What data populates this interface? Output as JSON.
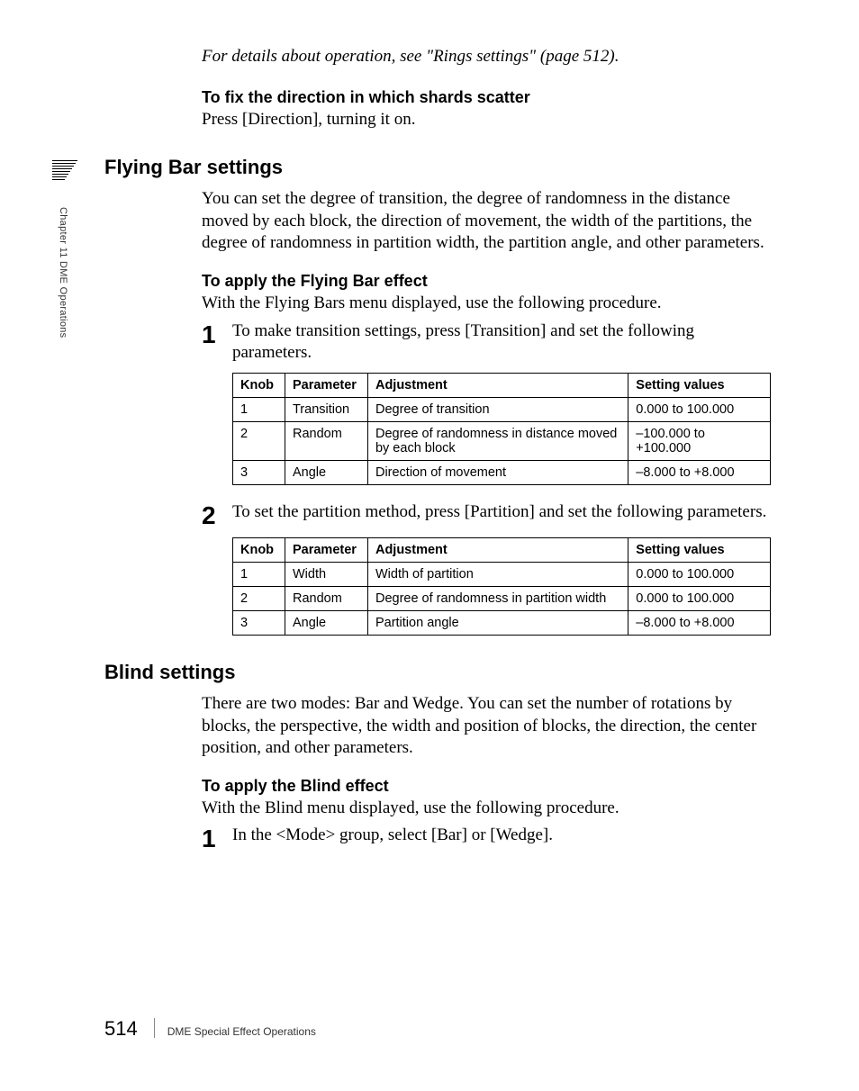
{
  "sidebar": {
    "chapter_label": "Chapter 11  DME Operations"
  },
  "intro": {
    "ref_italic": "For details about operation, see \"Rings settings\" (page 512).",
    "fix_dir_heading": "To fix the direction in which shards scatter",
    "fix_dir_body": "Press [Direction], turning it on."
  },
  "flying_bar": {
    "heading": "Flying Bar settings",
    "intro": "You can set the degree of transition, the degree of randomness in the distance moved by each block, the direction of movement, the width of the partitions, the degree of randomness in partition width, the partition angle, and other parameters.",
    "apply_heading": "To apply the Flying Bar effect",
    "apply_body": "With the Flying Bars menu displayed, use the following procedure.",
    "step1_num": "1",
    "step1_text": "To make transition settings, press [Transition] and set the following parameters.",
    "step2_num": "2",
    "step2_text": "To set the partition method, press [Partition] and set the following parameters.",
    "table_headers": {
      "knob": "Knob",
      "param": "Parameter",
      "adj": "Adjustment",
      "vals": "Setting values"
    },
    "table1": [
      {
        "knob": "1",
        "param": "Transition",
        "adj": "Degree of transition",
        "vals": "0.000 to 100.000"
      },
      {
        "knob": "2",
        "param": "Random",
        "adj": "Degree of randomness in distance moved by each block",
        "vals": "–100.000 to +100.000"
      },
      {
        "knob": "3",
        "param": "Angle",
        "adj": "Direction of movement",
        "vals": "–8.000 to +8.000"
      }
    ],
    "table2": [
      {
        "knob": "1",
        "param": "Width",
        "adj": "Width of partition",
        "vals": "0.000 to 100.000"
      },
      {
        "knob": "2",
        "param": "Random",
        "adj": "Degree of randomness in partition width",
        "vals": "0.000 to 100.000"
      },
      {
        "knob": "3",
        "param": "Angle",
        "adj": "Partition angle",
        "vals": "–8.000 to +8.000"
      }
    ]
  },
  "blind": {
    "heading": "Blind settings",
    "intro": "There are two modes: Bar and Wedge. You can set the number of rotations by blocks, the perspective, the width and position of blocks, the direction, the center position, and other parameters.",
    "apply_heading": "To apply the Blind effect",
    "apply_body": "With the Blind menu displayed, use the following procedure.",
    "step1_num": "1",
    "step1_text": "In the <Mode> group, select [Bar] or [Wedge]."
  },
  "footer": {
    "page": "514",
    "section": "DME Special Effect Operations"
  }
}
